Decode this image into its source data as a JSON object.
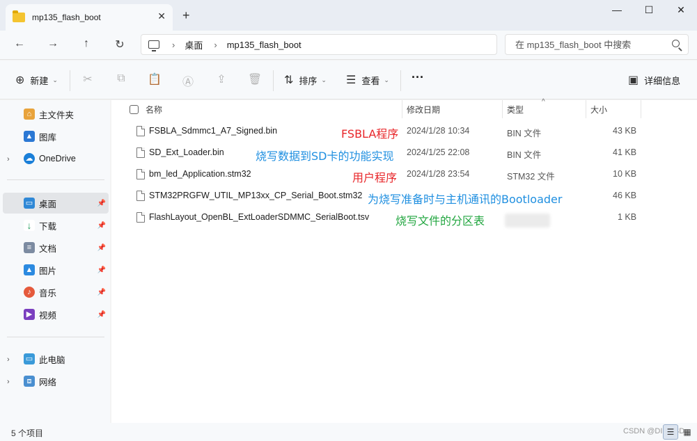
{
  "window": {
    "tab_title": "mp135_flash_boot",
    "tab_close": "✕",
    "new_tab": "+",
    "minimize": "—",
    "maximize": "☐",
    "close": "✕"
  },
  "nav": {
    "back": "←",
    "forward": "→",
    "up": "↑",
    "refresh": "↻",
    "breadcrumb": [
      "桌面",
      "mp135_flash_boot"
    ],
    "breadcrumb_sep": "›",
    "search_placeholder": "在 mp135_flash_boot 中搜索"
  },
  "toolbar": {
    "new_label": "新建",
    "sort_label": "排序",
    "view_label": "查看",
    "more_label": "···",
    "details_label": "详细信息"
  },
  "sidebar": {
    "items": [
      {
        "label": "主文件夹",
        "icon": "home-icon"
      },
      {
        "label": "图库",
        "icon": "gallery-icon"
      },
      {
        "label": "OneDrive",
        "icon": "onedrive-icon"
      },
      {
        "label": "桌面",
        "icon": "desktop-icon"
      },
      {
        "label": "下载",
        "icon": "download-icon"
      },
      {
        "label": "文档",
        "icon": "document-icon"
      },
      {
        "label": "图片",
        "icon": "picture-icon"
      },
      {
        "label": "音乐",
        "icon": "music-icon"
      },
      {
        "label": "视频",
        "icon": "video-icon"
      },
      {
        "label": "此电脑",
        "icon": "pc-icon"
      },
      {
        "label": "网络",
        "icon": "network-icon"
      }
    ]
  },
  "columns": {
    "name": "名称",
    "date": "修改日期",
    "type": "类型",
    "size": "大小"
  },
  "files": [
    {
      "name": "FSBLA_Sdmmc1_A7_Signed.bin",
      "date": "2024/1/28 10:34",
      "type": "BIN 文件",
      "size": "43 KB",
      "note": "FSBLA程序"
    },
    {
      "name": "SD_Ext_Loader.bin",
      "date": "2024/1/25 22:08",
      "type": "BIN 文件",
      "size": "41 KB",
      "note": "烧写数据到SD卡的功能实现"
    },
    {
      "name": "bm_led_Application.stm32",
      "date": "2024/1/28 23:54",
      "type": "STM32 文件",
      "size": "10 KB",
      "note": "用户程序"
    },
    {
      "name": "STM32PRGFW_UTIL_MP13xx_CP_Serial_Boot.stm32",
      "date": "",
      "type": "",
      "size": "46 KB",
      "note": "为烧写准备时与主机通讯的Bootloader"
    },
    {
      "name": "FlashLayout_OpenBL_ExtLoaderSDMMC_SerialBoot.tsv",
      "date": "",
      "type": "",
      "size": "1 KB",
      "note": "烧写文件的分区表"
    }
  ],
  "annotation_colors": {
    "red": "#e8262a",
    "blue": "#1f8fe0",
    "green": "#22a640"
  },
  "status": {
    "count": "5 个项目",
    "watermark": "CSDN @DIMSSD"
  }
}
